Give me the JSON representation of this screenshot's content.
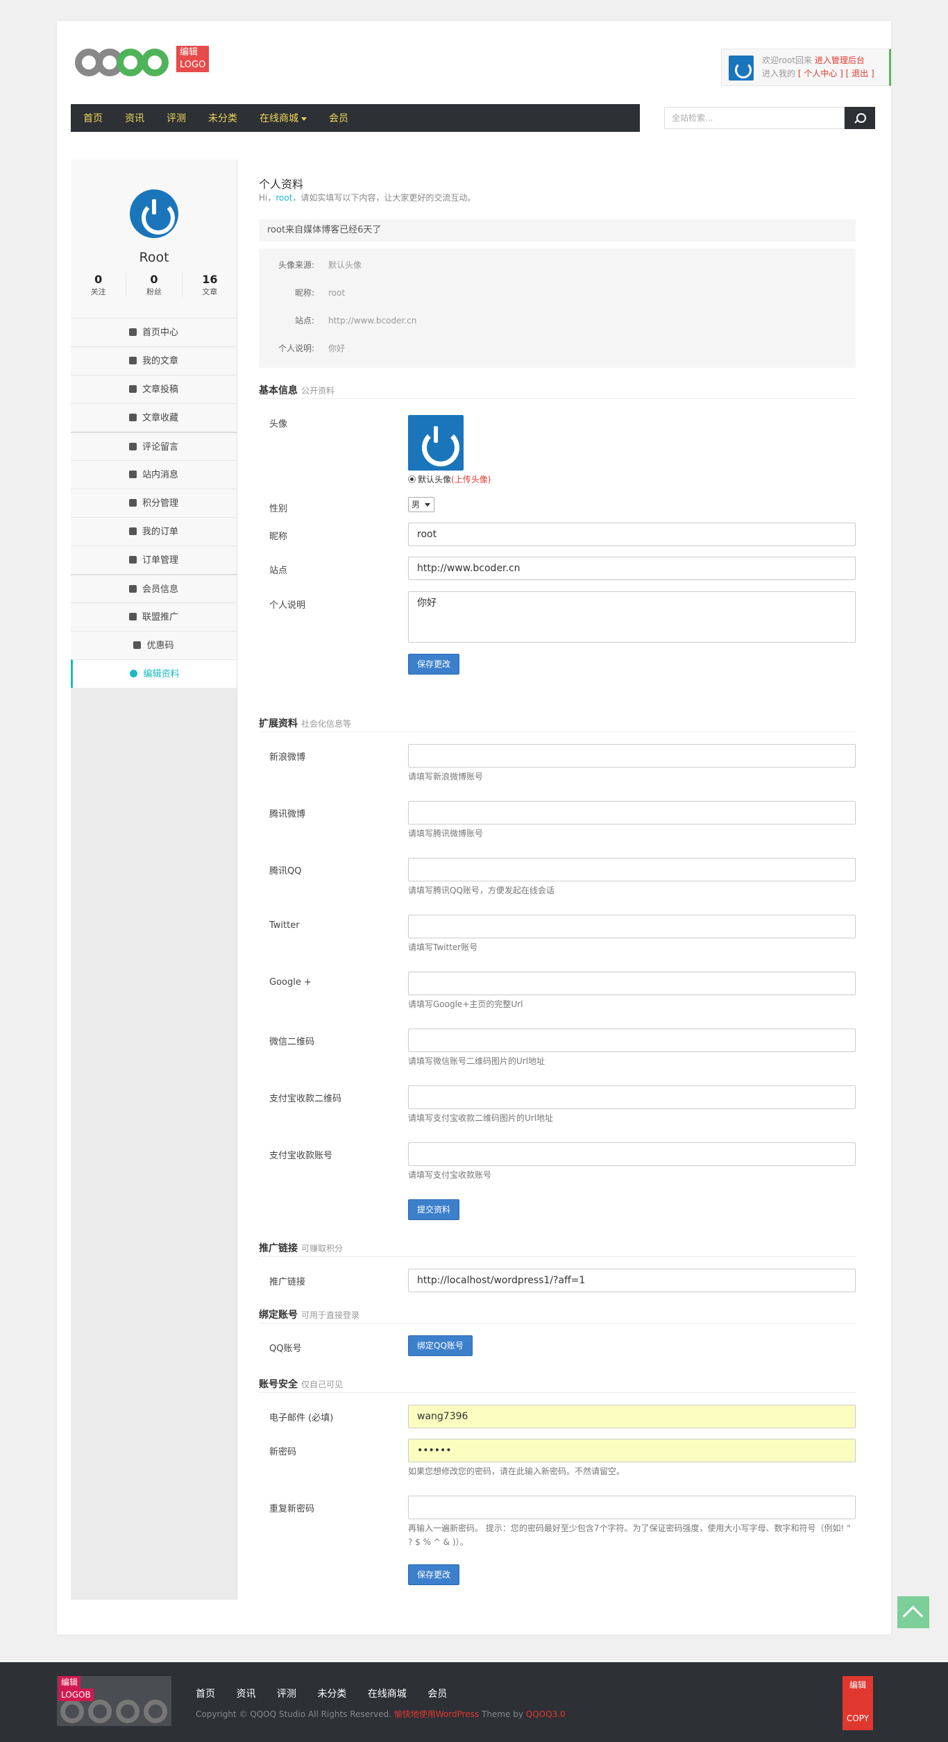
{
  "header": {
    "logo_tag": "编辑LOGO",
    "user_welcome": "欢迎root回来",
    "admin_link": "进入管理后台",
    "enter_my": "进入我的",
    "user_center": "[ 个人中心 ]",
    "logout": "[ 退出 ]",
    "nav": [
      "首页",
      "资讯",
      "评测",
      "未分类",
      "在线商城",
      "会员"
    ],
    "search_placeholder": "全站检索..."
  },
  "sidebar": {
    "name": "Root",
    "stats": [
      {
        "value": "0",
        "label": "关注"
      },
      {
        "value": "0",
        "label": "粉丝"
      },
      {
        "value": "16",
        "label": "文章"
      }
    ],
    "menu": [
      {
        "label": "首页中心",
        "icon": "dashboard-icon"
      },
      {
        "label": "我的文章",
        "icon": "cube-icon"
      },
      {
        "label": "文章投稿",
        "icon": "edit-icon"
      },
      {
        "label": "文章收藏",
        "icon": "star-icon"
      },
      {
        "label": "评论留言",
        "icon": "comments-icon"
      },
      {
        "label": "站内消息",
        "icon": "envelope-icon"
      },
      {
        "label": "积分管理",
        "icon": "credit-card-icon"
      },
      {
        "label": "我的订单",
        "icon": "cart-icon"
      },
      {
        "label": "订单管理",
        "icon": "list-icon"
      },
      {
        "label": "会员信息",
        "icon": "user-icon"
      },
      {
        "label": "联盟推广",
        "icon": "money-icon"
      },
      {
        "label": "优惠码",
        "icon": "tags-icon"
      },
      {
        "label": "编辑资料",
        "icon": "gear-icon"
      }
    ]
  },
  "profile": {
    "title": "个人资料",
    "hi_prefix": "Hi，",
    "hi_user": "root",
    "hi_suffix": "，请如实填写以下内容，让大家更好的交流互动。",
    "days": "root来自媒体博客已经6天了",
    "info": [
      {
        "label": "头像来源:",
        "value": "默认头像"
      },
      {
        "label": "昵称:",
        "value": "root"
      },
      {
        "label": "站点:",
        "value": "http://www.bcoder.cn"
      },
      {
        "label": "个人说明:",
        "value": "你好"
      }
    ]
  },
  "basic": {
    "title": "基本信息",
    "sub": "公开资料",
    "avatar_label": "头像",
    "avatar_default": "默认头像",
    "avatar_upload": "(上传头像)",
    "gender_label": "性别",
    "gender_value": "男",
    "nickname_label": "昵称",
    "nickname_value": "root",
    "site_label": "站点",
    "site_value": "http://www.bcoder.cn",
    "desc_label": "个人说明",
    "desc_value": "你好",
    "save": "保存更改"
  },
  "extended": {
    "title": "扩展资料",
    "sub": "社会化信息等",
    "fields": [
      {
        "label": "新浪微博",
        "hint": "请填写新浪微博账号"
      },
      {
        "label": "腾讯微博",
        "hint": "请填写腾讯微博账号"
      },
      {
        "label": "腾讯QQ",
        "hint": "请填写腾讯QQ账号，方便发起在线会话"
      },
      {
        "label": "Twitter",
        "hint": "请填写Twitter账号"
      },
      {
        "label": "Google +",
        "hint": "请填写Google+主页的完整Url"
      },
      {
        "label": "微信二维码",
        "hint": "请填写微信账号二维码图片的Url地址"
      },
      {
        "label": "支付宝收款二维码",
        "hint": "请填写支付宝收款二维码图片的Url地址"
      },
      {
        "label": "支付宝收款账号",
        "hint": "请填写支付宝收款账号"
      }
    ],
    "submit": "提交资料"
  },
  "promo": {
    "title": "推广链接",
    "sub": "可赚取积分",
    "label": "推广链接",
    "value": "http://localhost/wordpress1/?aff=1"
  },
  "bind": {
    "title": "绑定账号",
    "sub": "可用于直接登录",
    "label": "QQ账号",
    "button": "绑定QQ账号"
  },
  "security": {
    "title": "账号安全",
    "sub": "仅自己可见",
    "email_label": "电子邮件 (必填)",
    "email_value": "wang7396",
    "pwd_label": "新密码",
    "pwd_value": "••••••",
    "pwd_hint": "如果您想修改您的密码，请在此输入新密码。不然请留空。",
    "repeat_label": "重复新密码",
    "repeat_hint": "再输入一遍新密码。 提示：您的密码最好至少包含7个字符。为了保证密码强度，使用大小写字母、数字和符号（例如! \" ? $ % ^ & )）。",
    "save": "保存更改"
  },
  "footer": {
    "logo_tag1": "编辑",
    "logo_tag2": "LOGOB",
    "nav": [
      "首页",
      "资讯",
      "评测",
      "未分类",
      "在线商城",
      "会员"
    ],
    "copy_prefix": "Copyright © QQOQ Studio All Rights Reserved.",
    "copy_wp": "愉快地使用WordPress",
    "copy_theme": "Theme by",
    "copy_ver": "QQOQ3.0",
    "edit": "编辑",
    "copy_btn": "COPY"
  }
}
